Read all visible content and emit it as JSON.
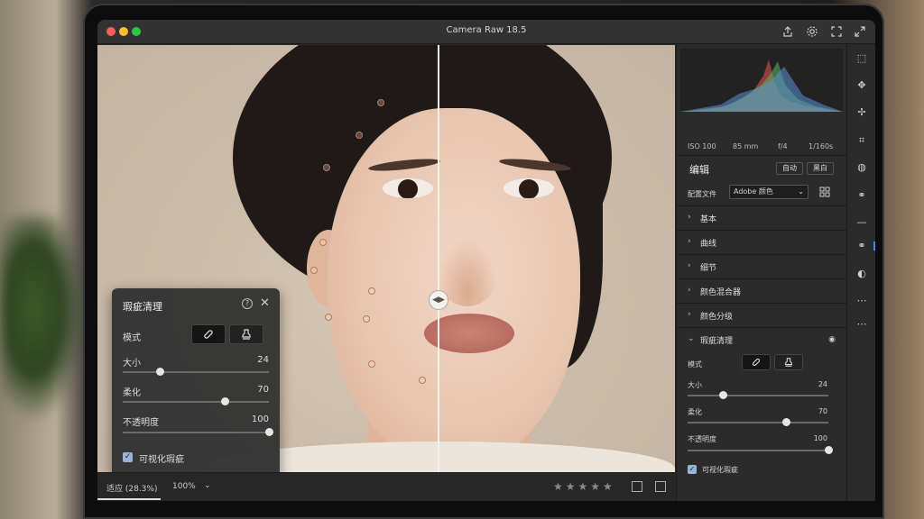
{
  "window": {
    "title": "Camera Raw 18.5"
  },
  "photo": {
    "split_handle_glyph": "◀▶"
  },
  "spot_panel": {
    "title": "瑕疵清理",
    "help_glyph": "?",
    "close_glyph": "✕",
    "mode_label": "模式",
    "size_label": "大小",
    "size_value": "24",
    "feather_label": "柔化",
    "feather_value": "70",
    "opacity_label": "不透明度",
    "opacity_value": "100",
    "visualize_label": "可视化瑕疵",
    "visualize_checked": true,
    "size_fraction": 0.25,
    "feather_fraction": 0.7,
    "opacity_fraction": 1.0
  },
  "bottom_bar": {
    "fit_label": "适应 (28.3%)",
    "zoom_label": "100%",
    "caret": "⌄",
    "stars": "★★★★★",
    "rating": 0
  },
  "right_panel": {
    "iso": "ISO 100",
    "focal": "85 mm",
    "aperture": "f/4",
    "shutter": "1/160s",
    "edit_title": "编辑",
    "auto_label": "自动",
    "bw_label": "黑白",
    "profile_label": "配置文件",
    "profile_value": "Adobe 颜色",
    "sections": [
      {
        "label": "基本",
        "chevron": "›"
      },
      {
        "label": "曲线",
        "chevron": "›"
      },
      {
        "label": "细节",
        "chevron": "›"
      },
      {
        "label": "颜色混合器",
        "chevron": "›"
      },
      {
        "label": "颜色分级",
        "chevron": "›"
      },
      {
        "label": "瑕疵清理",
        "chevron": "⌄"
      }
    ],
    "spot": {
      "mode_label": "模式",
      "size_label": "大小",
      "size_value": "24",
      "feather_label": "柔化",
      "feather_value": "70",
      "opacity_label": "不透明度",
      "opacity_value": "100",
      "visualize_label": "可视化瑕疵",
      "visualize_checked": true
    }
  },
  "colors": {
    "accent": "#4a88d8",
    "panel_bg": "#2b2b2b",
    "histogram_red": "#d9534f",
    "histogram_green": "#5cb85c",
    "histogram_blue": "#5b8fd6"
  }
}
